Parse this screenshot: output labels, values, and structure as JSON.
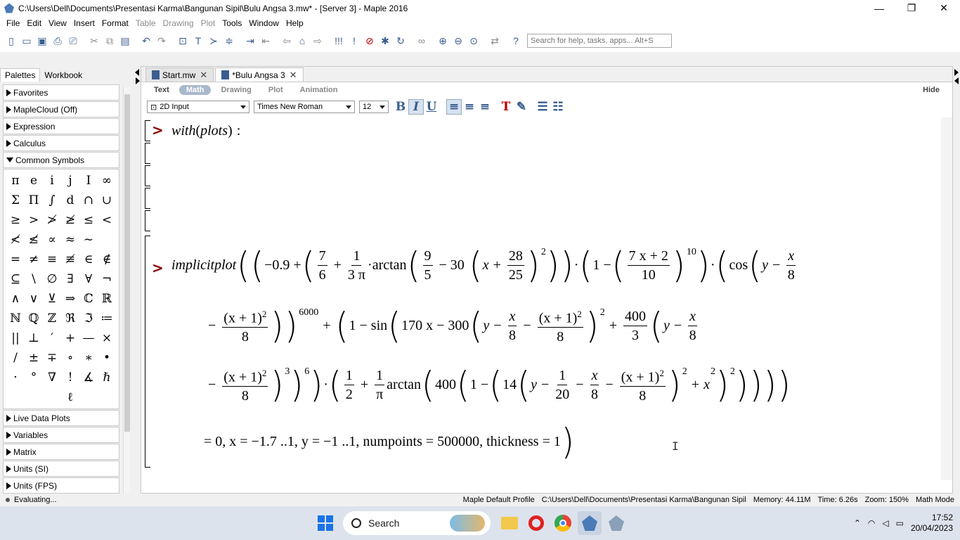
{
  "window": {
    "title": "C:\\Users\\Dell\\Documents\\Presentasi Karma\\Bangunan Sipil\\Bulu Angsa 3.mw* - [Server 3] - Maple 2016",
    "minimize": "—",
    "maximize": "❐",
    "close": "✕"
  },
  "menu": [
    "File",
    "Edit",
    "View",
    "Insert",
    "Format",
    "Table",
    "Drawing",
    "Plot",
    "Tools",
    "Window",
    "Help"
  ],
  "menu_disabled": [
    "Table",
    "Drawing",
    "Plot"
  ],
  "search": {
    "placeholder": "Search for help, tasks, apps... Alt+S"
  },
  "left_panel": {
    "tabs": [
      "Palettes",
      "Workbook"
    ],
    "palettes_top": [
      "Favorites",
      "MapleCloud (Off)",
      "Expression",
      "Calculus"
    ],
    "expanded": "Common Symbols",
    "symbols": [
      "π",
      "e",
      "i",
      "j",
      "I",
      "∞",
      "Σ",
      "Π",
      "∫",
      "d",
      "∩",
      "∪",
      "≥",
      ">",
      "≯",
      "≱",
      "≤",
      "<",
      "≮",
      "≰",
      "∝",
      "≈",
      "~",
      "",
      "=",
      "≠",
      "≡",
      "≢",
      "∈",
      "∉",
      "⊆",
      "\\",
      "∅",
      "∃",
      "∀",
      "¬",
      "∧",
      "∨",
      "⊻",
      "⇒",
      "ℂ",
      "ℝ",
      "ℕ",
      "ℚ",
      "ℤ",
      "ℜ",
      "ℑ",
      "≔",
      "||",
      "⊥",
      "′",
      "+",
      "—",
      "×",
      "/",
      "±",
      "∓",
      "∘",
      "∗",
      "•",
      "·",
      "°",
      "∇",
      "!",
      "∡",
      "ℏ",
      "ℓ"
    ],
    "palettes_bottom": [
      "Live Data Plots",
      "Variables",
      "Matrix",
      "Units (SI)",
      "Units (FPS)"
    ]
  },
  "doc_tabs": [
    {
      "label": "Start.mw",
      "close": "✕"
    },
    {
      "label": "*Bulu Angsa 3",
      "close": "✕"
    }
  ],
  "modes": [
    "Text",
    "Math",
    "Drawing",
    "Plot",
    "Animation"
  ],
  "active_mode": "Math",
  "hide_label": "Hide",
  "format": {
    "input_mode": "2D Input",
    "font": "Times New Roman",
    "size": "12",
    "bold": "B",
    "italic": "I",
    "underline": "U"
  },
  "worksheet": {
    "prompt": ">",
    "line1": {
      "cmd": "with",
      "arg": "plots",
      "colon": ":"
    },
    "implicit": {
      "cmd": "implicitplot",
      "a1": "−0.9 +",
      "f_7": "7",
      "f_6": "6",
      "plus": "+",
      "f_1": "1",
      "f_3pi": "3 π",
      "arctan": "arctan",
      "f_9": "9",
      "f_5": "5",
      "minus30": "− 30",
      "x": "x",
      "f_28": "28",
      "f_25": "25",
      "sq": "2",
      "one_minus": "1 −",
      "f_7x2": "7 x + 2",
      "f_10": "10",
      "pow10": "10",
      "cos": "cos",
      "y": "y",
      "f_8": "8",
      "f_xp1sq": "(x + 1)",
      "pow6000": "6000",
      "one_minus_sin": "1 − sin",
      "a_170": "170 x − 300",
      "f_400": "400",
      "f_3": "3",
      "pow3": "3",
      "pow6": "6",
      "f_half_num": "1",
      "f_half_den": "2",
      "f_pi": "π",
      "a_400": "400",
      "a_14": "14",
      "f_20": "20",
      "x2": "x",
      "tail": "= 0,  x = −1.7 ..1, y = −1 ..1, numpoints = 500000, thickness = 1"
    }
  },
  "status": {
    "left": "Evaluating...",
    "profile": "Maple Default Profile",
    "path": "C:\\Users\\Dell\\Documents\\Presentasi Karma\\Bangunan Sipil",
    "memory": "Memory: 44.11M",
    "time": "Time: 6.26s",
    "zoom": "Zoom: 150%",
    "mode": "Math Mode"
  },
  "taskbar": {
    "search": "Search",
    "time": "17:52",
    "date": "20/04/2023"
  }
}
